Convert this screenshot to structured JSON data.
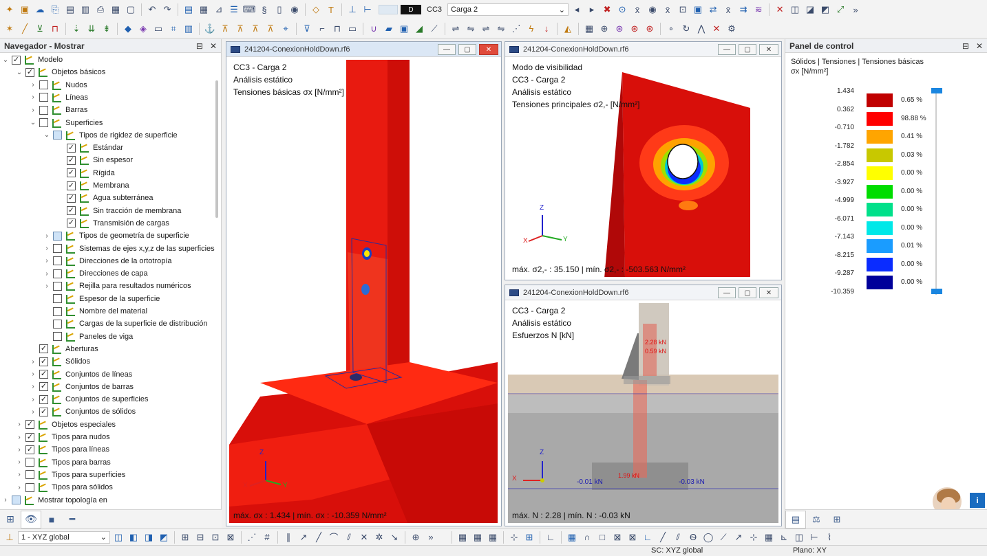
{
  "toolbar": {
    "load_case_code": "CC3",
    "load_case_name": "Carga 2",
    "display_mode": "D"
  },
  "navigator": {
    "title": "Navegador - Mostrar",
    "items": [
      {
        "label": "Modelo",
        "level": 0,
        "expand": "down",
        "check": "checked"
      },
      {
        "label": "Objetos básicos",
        "level": 1,
        "expand": "down",
        "check": "checked"
      },
      {
        "label": "Nudos",
        "level": 2,
        "expand": "right",
        "check": "unchecked"
      },
      {
        "label": "Líneas",
        "level": 2,
        "expand": "right",
        "check": "unchecked"
      },
      {
        "label": "Barras",
        "level": 2,
        "expand": "right",
        "check": "unchecked"
      },
      {
        "label": "Superficies",
        "level": 2,
        "expand": "down",
        "check": "unchecked"
      },
      {
        "label": "Tipos de rigidez de superficie",
        "level": 3,
        "expand": "down",
        "check": "partial"
      },
      {
        "label": "Estándar",
        "level": 4,
        "expand": "",
        "check": "checked"
      },
      {
        "label": "Sin espesor",
        "level": 4,
        "expand": "",
        "check": "checked"
      },
      {
        "label": "Rígida",
        "level": 4,
        "expand": "",
        "check": "checked"
      },
      {
        "label": "Membrana",
        "level": 4,
        "expand": "",
        "check": "checked"
      },
      {
        "label": "Agua subterránea",
        "level": 4,
        "expand": "",
        "check": "checked"
      },
      {
        "label": "Sin tracción de membrana",
        "level": 4,
        "expand": "",
        "check": "checked"
      },
      {
        "label": "Transmisión de cargas",
        "level": 4,
        "expand": "",
        "check": "checked"
      },
      {
        "label": "Tipos de geometría de superficie",
        "level": 3,
        "expand": "right",
        "check": "partial"
      },
      {
        "label": "Sistemas de ejes x,y,z de las superficies",
        "level": 3,
        "expand": "right",
        "check": "unchecked"
      },
      {
        "label": "Direcciones de la ortotropía",
        "level": 3,
        "expand": "right",
        "check": "unchecked"
      },
      {
        "label": "Direcciones de capa",
        "level": 3,
        "expand": "right",
        "check": "unchecked"
      },
      {
        "label": "Rejilla para resultados numéricos",
        "level": 3,
        "expand": "right",
        "check": "unchecked"
      },
      {
        "label": "Espesor de la superficie",
        "level": 3,
        "expand": "",
        "check": "unchecked"
      },
      {
        "label": "Nombre del material",
        "level": 3,
        "expand": "",
        "check": "unchecked"
      },
      {
        "label": "Cargas de la superficie de distribución",
        "level": 3,
        "expand": "",
        "check": "unchecked"
      },
      {
        "label": "Paneles de viga",
        "level": 3,
        "expand": "",
        "check": "unchecked"
      },
      {
        "label": "Aberturas",
        "level": 2,
        "expand": "",
        "check": "checked"
      },
      {
        "label": "Sólidos",
        "level": 2,
        "expand": "right",
        "check": "checked"
      },
      {
        "label": "Conjuntos de líneas",
        "level": 2,
        "expand": "right",
        "check": "checked"
      },
      {
        "label": "Conjuntos de barras",
        "level": 2,
        "expand": "right",
        "check": "checked"
      },
      {
        "label": "Conjuntos de superficies",
        "level": 2,
        "expand": "right",
        "check": "checked"
      },
      {
        "label": "Conjuntos de sólidos",
        "level": 2,
        "expand": "right",
        "check": "checked"
      },
      {
        "label": "Objetos especiales",
        "level": 1,
        "expand": "right",
        "check": "checked"
      },
      {
        "label": "Tipos para nudos",
        "level": 1,
        "expand": "right",
        "check": "checked"
      },
      {
        "label": "Tipos para líneas",
        "level": 1,
        "expand": "right",
        "check": "checked"
      },
      {
        "label": "Tipos para barras",
        "level": 1,
        "expand": "right",
        "check": "unchecked"
      },
      {
        "label": "Tipos para superficies",
        "level": 1,
        "expand": "right",
        "check": "unchecked"
      },
      {
        "label": "Tipos para sólidos",
        "level": 1,
        "expand": "right",
        "check": "unchecked"
      },
      {
        "label": "Mostrar topología en",
        "level": 0,
        "expand": "right",
        "check": "partial"
      }
    ]
  },
  "windows": {
    "left": {
      "title": "241204-ConexionHoldDown.rf6",
      "line1": "CC3 - Carga 2",
      "line2": "Análisis estático",
      "line3": "Tensiones básicas σx [N/mm²]",
      "footer": "máx. σx : 1.434 | mín. σx : -10.359 N/mm²"
    },
    "top_right": {
      "title": "241204-ConexionHoldDown.rf6",
      "line1": "Modo de visibilidad",
      "line2": "CC3 - Carga 2",
      "line3": "Análisis estático",
      "line4": "Tensiones principales σ2,- [N/mm²]",
      "footer": "máx. σ2,- : 35.150 | mín. σ2,- : -503.563 N/mm²"
    },
    "bottom_right": {
      "title": "241204-ConexionHoldDown.rf6",
      "line1": "CC3 - Carga 2",
      "line2": "Análisis estático",
      "line3": "Esfuerzos N [kN]",
      "label_a": "2.28 kN",
      "label_b": "0.59 kN",
      "label_c": "1.99 kN",
      "label_d": "-0.01 kN",
      "label_e": "-0.03 kN",
      "footer": "máx. N : 2.28 | mín. N : -0.03 kN"
    }
  },
  "axes": {
    "x": "X",
    "y": "Y",
    "z": "Z"
  },
  "control_panel": {
    "title": "Panel de control",
    "subtitle": "Sólidos | Tensiones | Tensiones básicas",
    "unit": "σx [N/mm²]",
    "values": [
      "1.434",
      "0.362",
      "-0.710",
      "-1.782",
      "-2.854",
      "-3.927",
      "-4.999",
      "-6.071",
      "-7.143",
      "-8.215",
      "-9.287",
      "-10.359"
    ],
    "bands": [
      {
        "color": "#c00000",
        "pct": "0.65 %"
      },
      {
        "color": "#ff0000",
        "pct": "98.88 %"
      },
      {
        "color": "#ffa500",
        "pct": "0.41 %"
      },
      {
        "color": "#c8c800",
        "pct": "0.03 %"
      },
      {
        "color": "#ffff00",
        "pct": "0.00 %"
      },
      {
        "color": "#00dd00",
        "pct": "0.00 %"
      },
      {
        "color": "#00e08a",
        "pct": "0.00 %"
      },
      {
        "color": "#00e8e8",
        "pct": "0.00 %"
      },
      {
        "color": "#1a9cff",
        "pct": "0.01 %"
      },
      {
        "color": "#0a2cff",
        "pct": "0.00 %"
      },
      {
        "color": "#00009a",
        "pct": "0.00 %"
      }
    ]
  },
  "bottom_toolbar": {
    "coord_system": "1 - XYZ global"
  },
  "status": {
    "sc": "SC: XYZ global",
    "plane": "Plano: XY"
  }
}
